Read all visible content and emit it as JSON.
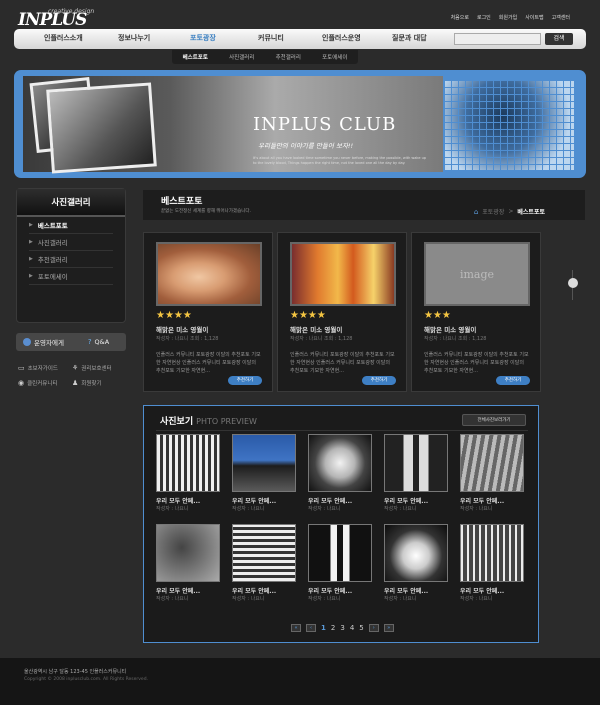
{
  "logo": {
    "main": "INPLUS",
    "sub": "creative design"
  },
  "util_links": [
    "처음으로",
    "로그인",
    "회원가입",
    "사이트맵",
    "고객센터"
  ],
  "gnb": {
    "items": [
      "인플러스소개",
      "정보나누기",
      "포토광장",
      "커뮤니티",
      "인플러스운영",
      "질문과 대답"
    ],
    "active_index": 2,
    "search_button": "검색"
  },
  "subnav": [
    "베스트포토",
    "사진갤러리",
    "추천갤러리",
    "포토에세이"
  ],
  "banner": {
    "title": "INPLUS CLUB",
    "subtitle": "우리들만의 이야기를 만들어 보자!!",
    "fine": "It's about all you have  looked time sometime you never before, making the possible, with wake up to the lovely blood, Things happen the right time, not the loved one all the day by day."
  },
  "sidebar": {
    "title": "사진갤러리",
    "items": [
      "베스트포토",
      "사진갤러리",
      "추천갤러리",
      "포토에세이"
    ],
    "buttons": [
      "운영자에게",
      "Q&A"
    ],
    "links": [
      "초보자가이드",
      "권리보호센터",
      "클린커뮤니티",
      "회원찾기"
    ]
  },
  "content_head": {
    "title": "베스트포토",
    "desc": "끝없는 도전정신 세계를 향해 뛰어나가겠습니다.",
    "crumbs": [
      "포토광장",
      "베스트포토"
    ]
  },
  "best_photos": [
    {
      "img": "baby",
      "stars": "★★★★",
      "title": "해맑은 미소 영월이",
      "meta": "작성자 : 나요니   조회 : 1,128",
      "desc": "인플러스 커뮤니티 포토광장 이달의 추천포토 기모한 자연현상 인플러스 커뮤니티 포토광장 이달의 추천포토 기모한 자연현...",
      "btn": "추천하기"
    },
    {
      "img": "drink",
      "stars": "★★★★",
      "title": "해맑은 미소 영월이",
      "meta": "작성자 : 나요니   조회 : 1,128",
      "desc": "인플러스 커뮤니티 포토광장 이달의 추천포토 기모한 자연현상 인플러스 커뮤니티 포토광장 이달의 추천포토 기모한 자연현...",
      "btn": "추천하기"
    },
    {
      "img": "empty",
      "img_text": "image",
      "stars": "★★★",
      "title": "해맑은 미소 영월이",
      "meta": "작성자 : 나요니   조회 : 1,128",
      "desc": "인플러스 커뮤니티 포토광장 이달의 추천포토 기모한 자연현상 인플러스 커뮤니티 포토광장 이달의 추천포토 기모한 자연현...",
      "btn": "추천하기"
    }
  ],
  "preview": {
    "title_ko": "사진보기",
    "title_en": "PHTO PREVIEW",
    "all_button": "전체사진보러가기",
    "thumbs": [
      {
        "style": "group",
        "title": "우리 모두 안페...",
        "meta": "작성자 : 나요니"
      },
      {
        "style": "sea",
        "title": "우리 모두 안페...",
        "meta": "작성자 : 나요니"
      },
      {
        "style": "bw",
        "title": "우리 모두 안페...",
        "meta": "작성자 : 나요니"
      },
      {
        "style": "feet",
        "title": "우리 모두 안페...",
        "meta": "작성자 : 나요니"
      },
      {
        "style": "road",
        "title": "우리 모두 안페...",
        "meta": "작성자 : 나요니"
      },
      {
        "style": "dog",
        "title": "우리 모두 안페...",
        "meta": "작성자 : 나요니"
      },
      {
        "style": "cross",
        "title": "우리 모두 안페...",
        "meta": "작성자 : 나요니"
      },
      {
        "style": "feet2",
        "title": "우리 모두 안페...",
        "meta": "작성자 : 나요니"
      },
      {
        "style": "bw2",
        "title": "우리 모두 안페...",
        "meta": "작성자 : 나요니"
      },
      {
        "style": "group2",
        "title": "우리 모두 안페...",
        "meta": "작성자 : 나요니"
      }
    ],
    "pages": [
      "1",
      "2",
      "3",
      "4",
      "5"
    ],
    "current_page": "1"
  },
  "footer": {
    "address": "울산광역시 남구 달동 123-45 인플러스커뮤니티",
    "copyright": "Copyright © 2008 inplusclub.com. All Rights Reserved."
  }
}
